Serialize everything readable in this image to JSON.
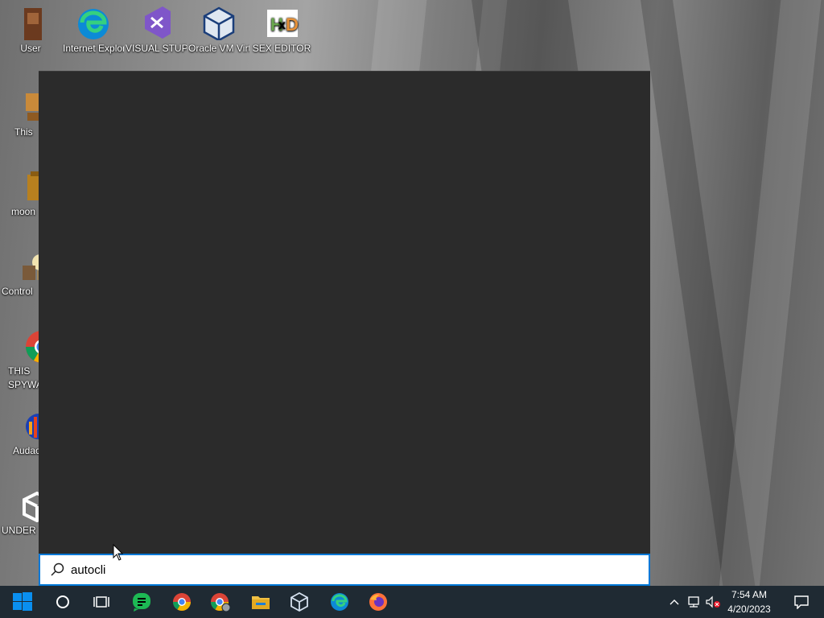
{
  "desktop": {
    "icons": [
      {
        "label": "User",
        "icon": "user-folder-icon"
      },
      {
        "label": "Internet Explorer",
        "icon": "edge-icon"
      },
      {
        "label": "VISUAL STUPI...",
        "icon": "visual-studio-icon"
      },
      {
        "label": "Oracle VM VirtualBox",
        "icon": "virtualbox-icon"
      },
      {
        "label": "SEX EDITOR",
        "icon": "hxd-icon"
      },
      {
        "label": "This",
        "icon": "this-pc-icon"
      },
      {
        "label": "moon",
        "icon": "folder-icon"
      },
      {
        "label": "Control",
        "icon": "control-panel-icon"
      },
      {
        "label": "THIS SPYWA",
        "icon": "chrome-icon"
      },
      {
        "label": "Audac",
        "icon": "audacity-icon"
      },
      {
        "label": "UNDER",
        "icon": "unity-icon"
      }
    ]
  },
  "search": {
    "query": "autocli",
    "placeholder": ""
  },
  "taskbar": {
    "items": [
      "start",
      "cortana",
      "task-view",
      "messages",
      "chrome",
      "chrome-profile",
      "file-explorer",
      "virtualbox",
      "edge",
      "firefox"
    ],
    "tray": {
      "time": "7:54 AM",
      "date": "4/20/2023"
    }
  },
  "colors": {
    "accent": "#0078d7",
    "panel": "#2b2b2b",
    "taskbar": "#1f2a33"
  }
}
